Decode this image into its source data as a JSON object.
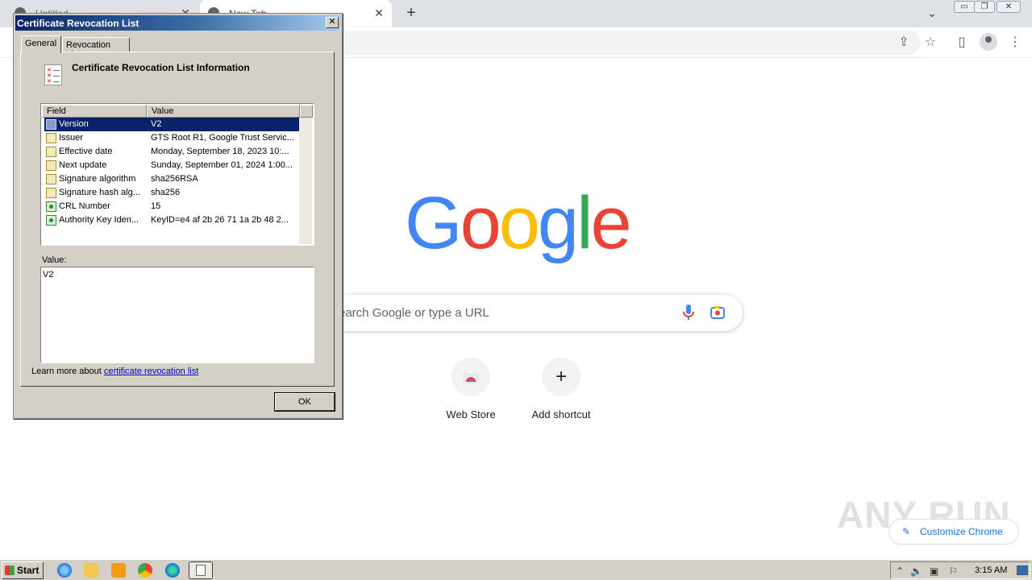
{
  "browser": {
    "tabs": [
      {
        "title": "Untitled"
      },
      {
        "title": "New Tab"
      }
    ],
    "new_tab_symbol": "+",
    "tab_close_symbol": "✕"
  },
  "new_tab_page": {
    "logo_letters": [
      {
        "ch": "G",
        "color": "#4285F4"
      },
      {
        "ch": "o",
        "color": "#EA4335"
      },
      {
        "ch": "o",
        "color": "#FBBC05"
      },
      {
        "ch": "g",
        "color": "#4285F4"
      },
      {
        "ch": "l",
        "color": "#34A853"
      },
      {
        "ch": "e",
        "color": "#EA4335"
      }
    ],
    "search_placeholder": "earch Google or type a URL",
    "shortcuts": [
      {
        "label": "Web Store",
        "icon": "web-store-icon"
      },
      {
        "label": "Add shortcut",
        "icon": "plus-icon",
        "symbol": "+"
      }
    ],
    "customize_label": "Customize Chrome",
    "watermark": "ANY RUN"
  },
  "dialog": {
    "title": "Certificate Revocation List",
    "close_symbol": "✕",
    "tabs": [
      {
        "label": "General",
        "active": true
      },
      {
        "label": "Revocation List",
        "active": false
      }
    ],
    "heading": "Certificate Revocation List Information",
    "columns": [
      "Field",
      "Value"
    ],
    "rows": [
      {
        "field": "Version",
        "value": "V2",
        "icon": "property-icon",
        "selected": true
      },
      {
        "field": "Issuer",
        "value": "GTS Root R1, Google Trust Servic...",
        "icon": "property-icon"
      },
      {
        "field": "Effective date",
        "value": "Monday, September 18, 2023 10:...",
        "icon": "property-icon"
      },
      {
        "field": "Next update",
        "value": "Sunday, September 01, 2024 1:00...",
        "icon": "property-icon"
      },
      {
        "field": "Signature algorithm",
        "value": "sha256RSA",
        "icon": "property-icon"
      },
      {
        "field": "Signature hash alg...",
        "value": "sha256",
        "icon": "property-icon"
      },
      {
        "field": "CRL Number",
        "value": "15",
        "icon": "extension-icon"
      },
      {
        "field": "Authority Key Iden...",
        "value": "KeyID=e4 af 2b 26 71 1a 2b 48 2...",
        "icon": "extension-icon"
      }
    ],
    "value_label": "Value:",
    "value_text": "V2",
    "learn_more_prefix": "Learn more about",
    "learn_more_link": "certificate revocation list",
    "ok_label": "OK"
  },
  "taskbar": {
    "start_label": "Start",
    "clock": "3:15 AM"
  }
}
